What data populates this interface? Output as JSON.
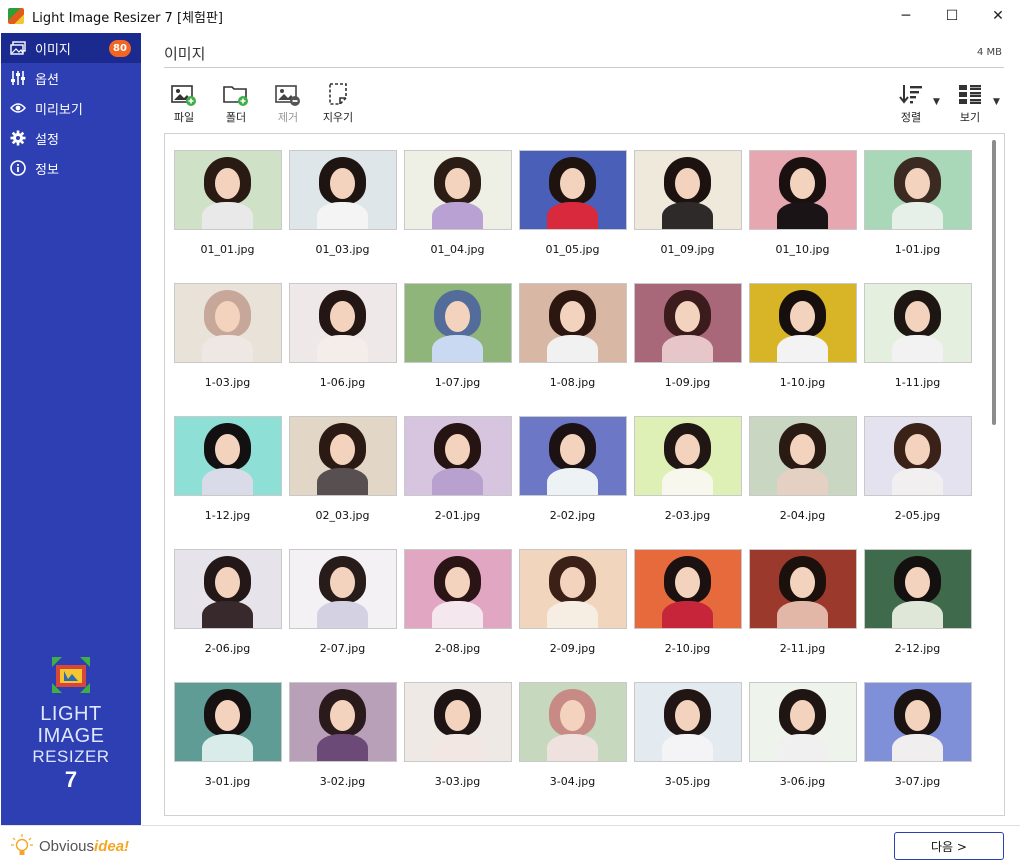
{
  "window": {
    "title": "Light Image Resizer 7  [체험판]",
    "controls": {
      "minimize": "─",
      "maximize": "☐",
      "close": "✕"
    }
  },
  "sidebar": {
    "items": [
      {
        "label": "이미지",
        "icon": "images-icon",
        "badge": "80",
        "active": true
      },
      {
        "label": "옵션",
        "icon": "sliders-icon"
      },
      {
        "label": "미리보기",
        "icon": "eye-icon"
      },
      {
        "label": "설정",
        "icon": "gear-icon"
      },
      {
        "label": "정보",
        "icon": "info-icon"
      }
    ],
    "logo": {
      "line1": "LIGHT",
      "line2": "IMAGE",
      "line3": "RESIZER",
      "line4": "7"
    },
    "brand": {
      "part1": "Obvious",
      "part2": "idea!"
    }
  },
  "main": {
    "title": "이미지",
    "size": "4 MB",
    "toolbar": {
      "file": "파일",
      "folder": "폴더",
      "remove": "제거",
      "clear": "지우기",
      "sort": "정렬",
      "view": "보기"
    },
    "images": [
      {
        "name": "01_01.jpg",
        "bg": "#cfe2c8",
        "hair": "#2a1a14",
        "body": "#e9e9e9"
      },
      {
        "name": "01_03.jpg",
        "bg": "#dfe6ea",
        "hair": "#1e1512",
        "body": "#f4f4f4"
      },
      {
        "name": "01_04.jpg",
        "bg": "#eef0e6",
        "hair": "#2b1c16",
        "body": "#b9a2d3"
      },
      {
        "name": "01_05.jpg",
        "bg": "#4a5fb8",
        "hair": "#1f130f",
        "body": "#d82a3c"
      },
      {
        "name": "01_09.jpg",
        "bg": "#efe9dc",
        "hair": "#1c1310",
        "body": "#2e2a2a"
      },
      {
        "name": "01_10.jpg",
        "bg": "#e7a7b1",
        "hair": "#1a1010",
        "body": "#1a1416"
      },
      {
        "name": "1-01.jpg",
        "bg": "#a9d8b9",
        "hair": "#3a2a22",
        "body": "#e7efe9"
      },
      {
        "name": "1-03.jpg",
        "bg": "#e9e2d8",
        "hair": "#c7a79a",
        "body": "#efe7e3"
      },
      {
        "name": "1-06.jpg",
        "bg": "#eee8e9",
        "hair": "#231614",
        "body": "#f4ede9"
      },
      {
        "name": "1-07.jpg",
        "bg": "#8fb57a",
        "hair": "#546c9a",
        "body": "#c9d9f1"
      },
      {
        "name": "1-08.jpg",
        "bg": "#d8b7a4",
        "hair": "#2b1710",
        "body": "#f1f1f1"
      },
      {
        "name": "1-09.jpg",
        "bg": "#a9677a",
        "hair": "#3b1b1b",
        "body": "#e6c6c8"
      },
      {
        "name": "1-10.jpg",
        "bg": "#d7b526",
        "hair": "#160f0d",
        "body": "#f3f3f3"
      },
      {
        "name": "1-11.jpg",
        "bg": "#e4efe0",
        "hair": "#1e1613",
        "body": "#f2f2f2"
      },
      {
        "name": "1-12.jpg",
        "bg": "#8ee0d6",
        "hair": "#121010",
        "body": "#dadbe8"
      },
      {
        "name": "02_03.jpg",
        "bg": "#e2d6c7",
        "hair": "#2b1a14",
        "body": "#585050"
      },
      {
        "name": "2-01.jpg",
        "bg": "#d7c4de",
        "hair": "#251412",
        "body": "#b8a0cf"
      },
      {
        "name": "2-02.jpg",
        "bg": "#6c77c6",
        "hair": "#1c1214",
        "body": "#edf2f5"
      },
      {
        "name": "2-03.jpg",
        "bg": "#dff0b7",
        "hair": "#201714",
        "body": "#f7f7ee"
      },
      {
        "name": "2-04.jpg",
        "bg": "#c9d6c2",
        "hair": "#2a1a14",
        "body": "#e4d1c3"
      },
      {
        "name": "2-05.jpg",
        "bg": "#e3e2ee",
        "hair": "#3b2218",
        "body": "#f1efef"
      },
      {
        "name": "2-06.jpg",
        "bg": "#e6e4ea",
        "hair": "#241718",
        "body": "#382a2c"
      },
      {
        "name": "2-07.jpg",
        "bg": "#f4f1f5",
        "hair": "#281c1a",
        "body": "#d4d2e2"
      },
      {
        "name": "2-08.jpg",
        "bg": "#e1a7c2",
        "hair": "#2b1416",
        "body": "#f4e7ee"
      },
      {
        "name": "2-09.jpg",
        "bg": "#f1d6bd",
        "hair": "#3a2017",
        "body": "#f6ede3"
      },
      {
        "name": "2-10.jpg",
        "bg": "#e66a3c",
        "hair": "#1a1110",
        "body": "#c7263a"
      },
      {
        "name": "2-11.jpg",
        "bg": "#9b3a2c",
        "hair": "#1c100d",
        "body": "#e3b7a7"
      },
      {
        "name": "2-12.jpg",
        "bg": "#3f6a4b",
        "hair": "#151010",
        "body": "#dfe7d9"
      },
      {
        "name": "3-01.jpg",
        "bg": "#5f9c95",
        "hair": "#161010",
        "body": "#d9ece9"
      },
      {
        "name": "3-02.jpg",
        "bg": "#b7a0b8",
        "hair": "#2a1a1c",
        "body": "#6b4a77"
      },
      {
        "name": "3-03.jpg",
        "bg": "#efe9e6",
        "hair": "#1e1413",
        "body": "#f3e7e4"
      },
      {
        "name": "3-04.jpg",
        "bg": "#c6d8bd",
        "hair": "#c78a84",
        "body": "#efe1dd"
      },
      {
        "name": "3-05.jpg",
        "bg": "#e4ebf0",
        "hair": "#221615",
        "body": "#f4f4f6"
      },
      {
        "name": "3-06.jpg",
        "bg": "#eef3ec",
        "hair": "#1f1513",
        "body": "#f0f0f0"
      },
      {
        "name": "3-07.jpg",
        "bg": "#7f8fd8",
        "hair": "#1b1212",
        "body": "#f1eef0"
      }
    ]
  },
  "footer": {
    "next": "다음 >"
  }
}
